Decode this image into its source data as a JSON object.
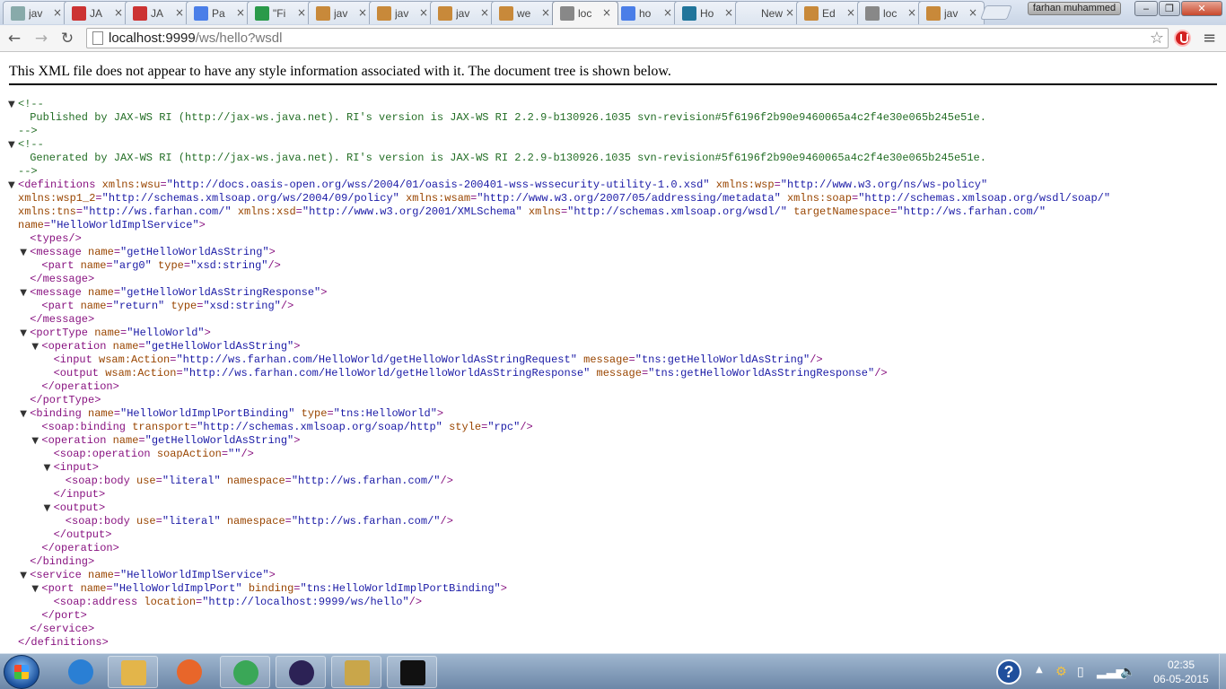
{
  "browser": {
    "tabs": [
      {
        "title": "jav",
        "icon": "page-icon",
        "color": "#8aa"
      },
      {
        "title": "JA",
        "icon": "question-icon",
        "color": "#c33"
      },
      {
        "title": "JA",
        "icon": "question-icon",
        "color": "#c33"
      },
      {
        "title": "Pa",
        "icon": "google-icon",
        "color": "#4a7ee8"
      },
      {
        "title": "\"Fi",
        "icon": "refresh-icon",
        "color": "#2a9a4a"
      },
      {
        "title": "jav",
        "icon": "coffee-icon",
        "color": "#c8893a"
      },
      {
        "title": "jav",
        "icon": "coffee-icon",
        "color": "#c8893a"
      },
      {
        "title": "jav",
        "icon": "coffee-icon",
        "color": "#c8893a"
      },
      {
        "title": "we",
        "icon": "coffee-icon",
        "color": "#c8893a"
      },
      {
        "title": "loc",
        "icon": "page-icon",
        "color": "#888",
        "active": true
      },
      {
        "title": "ho",
        "icon": "google-icon",
        "color": "#4a7ee8"
      },
      {
        "title": "Ho",
        "icon": "wordpress-icon",
        "color": "#21759b"
      },
      {
        "title": "New",
        "icon": "blank-icon",
        "color": ""
      },
      {
        "title": "Ed",
        "icon": "coffee-icon",
        "color": "#c8893a"
      },
      {
        "title": "loc",
        "icon": "page-icon",
        "color": "#888"
      },
      {
        "title": "jav",
        "icon": "coffee-icon",
        "color": "#c8893a"
      }
    ],
    "profile_name": "farhan muhammed",
    "url_host": "localhost:9999",
    "url_path": "/ws/hello?wsdl",
    "window_buttons": {
      "minimize": "‒",
      "maximize": "❐",
      "close": "✕"
    }
  },
  "xml": {
    "header": "This XML file does not appear to have any style information associated with it. The document tree is shown below.",
    "lines": [
      {
        "i": 0,
        "tri": true,
        "parts": [
          [
            "cm",
            "<!--"
          ]
        ]
      },
      {
        "i": 1,
        "parts": [
          [
            "cm",
            "Published by JAX-WS RI (http://jax-ws.java.net). RI's version is JAX-WS RI 2.2.9-b130926.1035 svn-revision#5f6196f2b90e9460065a4c2f4e30e065b245e51e."
          ]
        ]
      },
      {
        "i": 0,
        "parts": [
          [
            "cm",
            "-->"
          ]
        ]
      },
      {
        "i": 0,
        "tri": true,
        "parts": [
          [
            "cm",
            "<!--"
          ]
        ]
      },
      {
        "i": 1,
        "parts": [
          [
            "cm",
            "Generated by JAX-WS RI (http://jax-ws.java.net). RI's version is JAX-WS RI 2.2.9-b130926.1035 svn-revision#5f6196f2b90e9460065a4c2f4e30e065b245e51e."
          ]
        ]
      },
      {
        "i": 0,
        "parts": [
          [
            "cm",
            "-->"
          ]
        ]
      },
      {
        "i": 0,
        "tri": true,
        "parts": [
          [
            "t",
            "<definitions"
          ],
          [
            "",
            " "
          ],
          [
            "an",
            "xmlns:wsu"
          ],
          [
            "t",
            "="
          ],
          [
            "av",
            "\"http://docs.oasis-open.org/wss/2004/01/oasis-200401-wss-wssecurity-utility-1.0.xsd\""
          ],
          [
            "",
            " "
          ],
          [
            "an",
            "xmlns:wsp"
          ],
          [
            "t",
            "="
          ],
          [
            "av",
            "\"http://www.w3.org/ns/ws-policy\""
          ]
        ]
      },
      {
        "i": 0,
        "parts": [
          [
            "an",
            "xmlns:wsp1_2"
          ],
          [
            "t",
            "="
          ],
          [
            "av",
            "\"http://schemas.xmlsoap.org/ws/2004/09/policy\""
          ],
          [
            "",
            " "
          ],
          [
            "an",
            "xmlns:wsam"
          ],
          [
            "t",
            "="
          ],
          [
            "av",
            "\"http://www.w3.org/2007/05/addressing/metadata\""
          ],
          [
            "",
            " "
          ],
          [
            "an",
            "xmlns:soap"
          ],
          [
            "t",
            "="
          ],
          [
            "av",
            "\"http://schemas.xmlsoap.org/wsdl/soap/\""
          ]
        ]
      },
      {
        "i": 0,
        "parts": [
          [
            "an",
            "xmlns:tns"
          ],
          [
            "t",
            "="
          ],
          [
            "av",
            "\"http://ws.farhan.com/\""
          ],
          [
            "",
            " "
          ],
          [
            "an",
            "xmlns:xsd"
          ],
          [
            "t",
            "="
          ],
          [
            "av",
            "\"http://www.w3.org/2001/XMLSchema\""
          ],
          [
            "",
            " "
          ],
          [
            "an",
            "xmlns"
          ],
          [
            "t",
            "="
          ],
          [
            "av",
            "\"http://schemas.xmlsoap.org/wsdl/\""
          ],
          [
            "",
            " "
          ],
          [
            "an",
            "targetNamespace"
          ],
          [
            "t",
            "="
          ],
          [
            "av",
            "\"http://ws.farhan.com/\""
          ]
        ]
      },
      {
        "i": 0,
        "parts": [
          [
            "an",
            "name"
          ],
          [
            "t",
            "="
          ],
          [
            "av",
            "\"HelloWorldImplService\""
          ],
          [
            "t",
            ">"
          ]
        ]
      },
      {
        "i": 1,
        "parts": [
          [
            "t",
            "<types/>"
          ]
        ]
      },
      {
        "i": 1,
        "tri": true,
        "parts": [
          [
            "t",
            "<message"
          ],
          [
            "",
            " "
          ],
          [
            "an",
            "name"
          ],
          [
            "t",
            "="
          ],
          [
            "av",
            "\"getHelloWorldAsString\""
          ],
          [
            "t",
            ">"
          ]
        ]
      },
      {
        "i": 2,
        "parts": [
          [
            "t",
            "<part"
          ],
          [
            "",
            " "
          ],
          [
            "an",
            "name"
          ],
          [
            "t",
            "="
          ],
          [
            "av",
            "\"arg0\""
          ],
          [
            "",
            " "
          ],
          [
            "an",
            "type"
          ],
          [
            "t",
            "="
          ],
          [
            "av",
            "\"xsd:string\""
          ],
          [
            "t",
            "/>"
          ]
        ]
      },
      {
        "i": 1,
        "parts": [
          [
            "t",
            "</message>"
          ]
        ]
      },
      {
        "i": 1,
        "tri": true,
        "parts": [
          [
            "t",
            "<message"
          ],
          [
            "",
            " "
          ],
          [
            "an",
            "name"
          ],
          [
            "t",
            "="
          ],
          [
            "av",
            "\"getHelloWorldAsStringResponse\""
          ],
          [
            "t",
            ">"
          ]
        ]
      },
      {
        "i": 2,
        "parts": [
          [
            "t",
            "<part"
          ],
          [
            "",
            " "
          ],
          [
            "an",
            "name"
          ],
          [
            "t",
            "="
          ],
          [
            "av",
            "\"return\""
          ],
          [
            "",
            " "
          ],
          [
            "an",
            "type"
          ],
          [
            "t",
            "="
          ],
          [
            "av",
            "\"xsd:string\""
          ],
          [
            "t",
            "/>"
          ]
        ]
      },
      {
        "i": 1,
        "parts": [
          [
            "t",
            "</message>"
          ]
        ]
      },
      {
        "i": 1,
        "tri": true,
        "parts": [
          [
            "t",
            "<portType"
          ],
          [
            "",
            " "
          ],
          [
            "an",
            "name"
          ],
          [
            "t",
            "="
          ],
          [
            "av",
            "\"HelloWorld\""
          ],
          [
            "t",
            ">"
          ]
        ]
      },
      {
        "i": 2,
        "tri": true,
        "parts": [
          [
            "t",
            "<operation"
          ],
          [
            "",
            " "
          ],
          [
            "an",
            "name"
          ],
          [
            "t",
            "="
          ],
          [
            "av",
            "\"getHelloWorldAsString\""
          ],
          [
            "t",
            ">"
          ]
        ]
      },
      {
        "i": 3,
        "parts": [
          [
            "t",
            "<input"
          ],
          [
            "",
            " "
          ],
          [
            "an",
            "wsam:Action"
          ],
          [
            "t",
            "="
          ],
          [
            "av",
            "\"http://ws.farhan.com/HelloWorld/getHelloWorldAsStringRequest\""
          ],
          [
            "",
            " "
          ],
          [
            "an",
            "message"
          ],
          [
            "t",
            "="
          ],
          [
            "av",
            "\"tns:getHelloWorldAsString\""
          ],
          [
            "t",
            "/>"
          ]
        ]
      },
      {
        "i": 3,
        "parts": [
          [
            "t",
            "<output"
          ],
          [
            "",
            " "
          ],
          [
            "an",
            "wsam:Action"
          ],
          [
            "t",
            "="
          ],
          [
            "av",
            "\"http://ws.farhan.com/HelloWorld/getHelloWorldAsStringResponse\""
          ],
          [
            "",
            " "
          ],
          [
            "an",
            "message"
          ],
          [
            "t",
            "="
          ],
          [
            "av",
            "\"tns:getHelloWorldAsStringResponse\""
          ],
          [
            "t",
            "/>"
          ]
        ]
      },
      {
        "i": 2,
        "parts": [
          [
            "t",
            "</operation>"
          ]
        ]
      },
      {
        "i": 1,
        "parts": [
          [
            "t",
            "</portType>"
          ]
        ]
      },
      {
        "i": 1,
        "tri": true,
        "parts": [
          [
            "t",
            "<binding"
          ],
          [
            "",
            " "
          ],
          [
            "an",
            "name"
          ],
          [
            "t",
            "="
          ],
          [
            "av",
            "\"HelloWorldImplPortBinding\""
          ],
          [
            "",
            " "
          ],
          [
            "an",
            "type"
          ],
          [
            "t",
            "="
          ],
          [
            "av",
            "\"tns:HelloWorld\""
          ],
          [
            "t",
            ">"
          ]
        ]
      },
      {
        "i": 2,
        "parts": [
          [
            "t",
            "<soap:binding"
          ],
          [
            "",
            " "
          ],
          [
            "an",
            "transport"
          ],
          [
            "t",
            "="
          ],
          [
            "av",
            "\"http://schemas.xmlsoap.org/soap/http\""
          ],
          [
            "",
            " "
          ],
          [
            "an",
            "style"
          ],
          [
            "t",
            "="
          ],
          [
            "av",
            "\"rpc\""
          ],
          [
            "t",
            "/>"
          ]
        ]
      },
      {
        "i": 2,
        "tri": true,
        "parts": [
          [
            "t",
            "<operation"
          ],
          [
            "",
            " "
          ],
          [
            "an",
            "name"
          ],
          [
            "t",
            "="
          ],
          [
            "av",
            "\"getHelloWorldAsString\""
          ],
          [
            "t",
            ">"
          ]
        ]
      },
      {
        "i": 3,
        "parts": [
          [
            "t",
            "<soap:operation"
          ],
          [
            "",
            " "
          ],
          [
            "an",
            "soapAction"
          ],
          [
            "t",
            "="
          ],
          [
            "av",
            "\"\""
          ],
          [
            "t",
            "/>"
          ]
        ]
      },
      {
        "i": 3,
        "tri": true,
        "parts": [
          [
            "t",
            "<input>"
          ]
        ]
      },
      {
        "i": 4,
        "parts": [
          [
            "t",
            "<soap:body"
          ],
          [
            "",
            " "
          ],
          [
            "an",
            "use"
          ],
          [
            "t",
            "="
          ],
          [
            "av",
            "\"literal\""
          ],
          [
            "",
            " "
          ],
          [
            "an",
            "namespace"
          ],
          [
            "t",
            "="
          ],
          [
            "av",
            "\"http://ws.farhan.com/\""
          ],
          [
            "t",
            "/>"
          ]
        ]
      },
      {
        "i": 3,
        "parts": [
          [
            "t",
            "</input>"
          ]
        ]
      },
      {
        "i": 3,
        "tri": true,
        "parts": [
          [
            "t",
            "<output>"
          ]
        ]
      },
      {
        "i": 4,
        "parts": [
          [
            "t",
            "<soap:body"
          ],
          [
            "",
            " "
          ],
          [
            "an",
            "use"
          ],
          [
            "t",
            "="
          ],
          [
            "av",
            "\"literal\""
          ],
          [
            "",
            " "
          ],
          [
            "an",
            "namespace"
          ],
          [
            "t",
            "="
          ],
          [
            "av",
            "\"http://ws.farhan.com/\""
          ],
          [
            "t",
            "/>"
          ]
        ]
      },
      {
        "i": 3,
        "parts": [
          [
            "t",
            "</output>"
          ]
        ]
      },
      {
        "i": 2,
        "parts": [
          [
            "t",
            "</operation>"
          ]
        ]
      },
      {
        "i": 1,
        "parts": [
          [
            "t",
            "</binding>"
          ]
        ]
      },
      {
        "i": 1,
        "tri": true,
        "parts": [
          [
            "t",
            "<service"
          ],
          [
            "",
            " "
          ],
          [
            "an",
            "name"
          ],
          [
            "t",
            "="
          ],
          [
            "av",
            "\"HelloWorldImplService\""
          ],
          [
            "t",
            ">"
          ]
        ]
      },
      {
        "i": 2,
        "tri": true,
        "parts": [
          [
            "t",
            "<port"
          ],
          [
            "",
            " "
          ],
          [
            "an",
            "name"
          ],
          [
            "t",
            "="
          ],
          [
            "av",
            "\"HelloWorldImplPort\""
          ],
          [
            "",
            " "
          ],
          [
            "an",
            "binding"
          ],
          [
            "t",
            "="
          ],
          [
            "av",
            "\"tns:HelloWorldImplPortBinding\""
          ],
          [
            "t",
            ">"
          ]
        ]
      },
      {
        "i": 3,
        "parts": [
          [
            "t",
            "<soap:address"
          ],
          [
            "",
            " "
          ],
          [
            "an",
            "location"
          ],
          [
            "t",
            "="
          ],
          [
            "av",
            "\"http://localhost:9999/ws/hello\""
          ],
          [
            "t",
            "/>"
          ]
        ]
      },
      {
        "i": 2,
        "parts": [
          [
            "t",
            "</port>"
          ]
        ]
      },
      {
        "i": 1,
        "parts": [
          [
            "t",
            "</service>"
          ]
        ]
      },
      {
        "i": 0,
        "parts": [
          [
            "t",
            "</definitions>"
          ]
        ]
      }
    ]
  },
  "taskbar": {
    "apps": [
      {
        "name": "internet-explorer",
        "color": "#2a7fd4",
        "pinned": false
      },
      {
        "name": "file-explorer",
        "color": "#e3b54a",
        "pinned": true
      },
      {
        "name": "firefox",
        "color": "#e8662a",
        "pinned": false
      },
      {
        "name": "chrome",
        "color": "#3aa757",
        "pinned": true
      },
      {
        "name": "eclipse",
        "color": "#2c2255",
        "pinned": true
      },
      {
        "name": "paint",
        "color": "#c9a64a",
        "pinned": true
      },
      {
        "name": "command-prompt",
        "color": "#111111",
        "pinned": true
      }
    ],
    "help_glyph": "?",
    "clock_time": "02:35",
    "clock_date": "06-05-2015"
  }
}
